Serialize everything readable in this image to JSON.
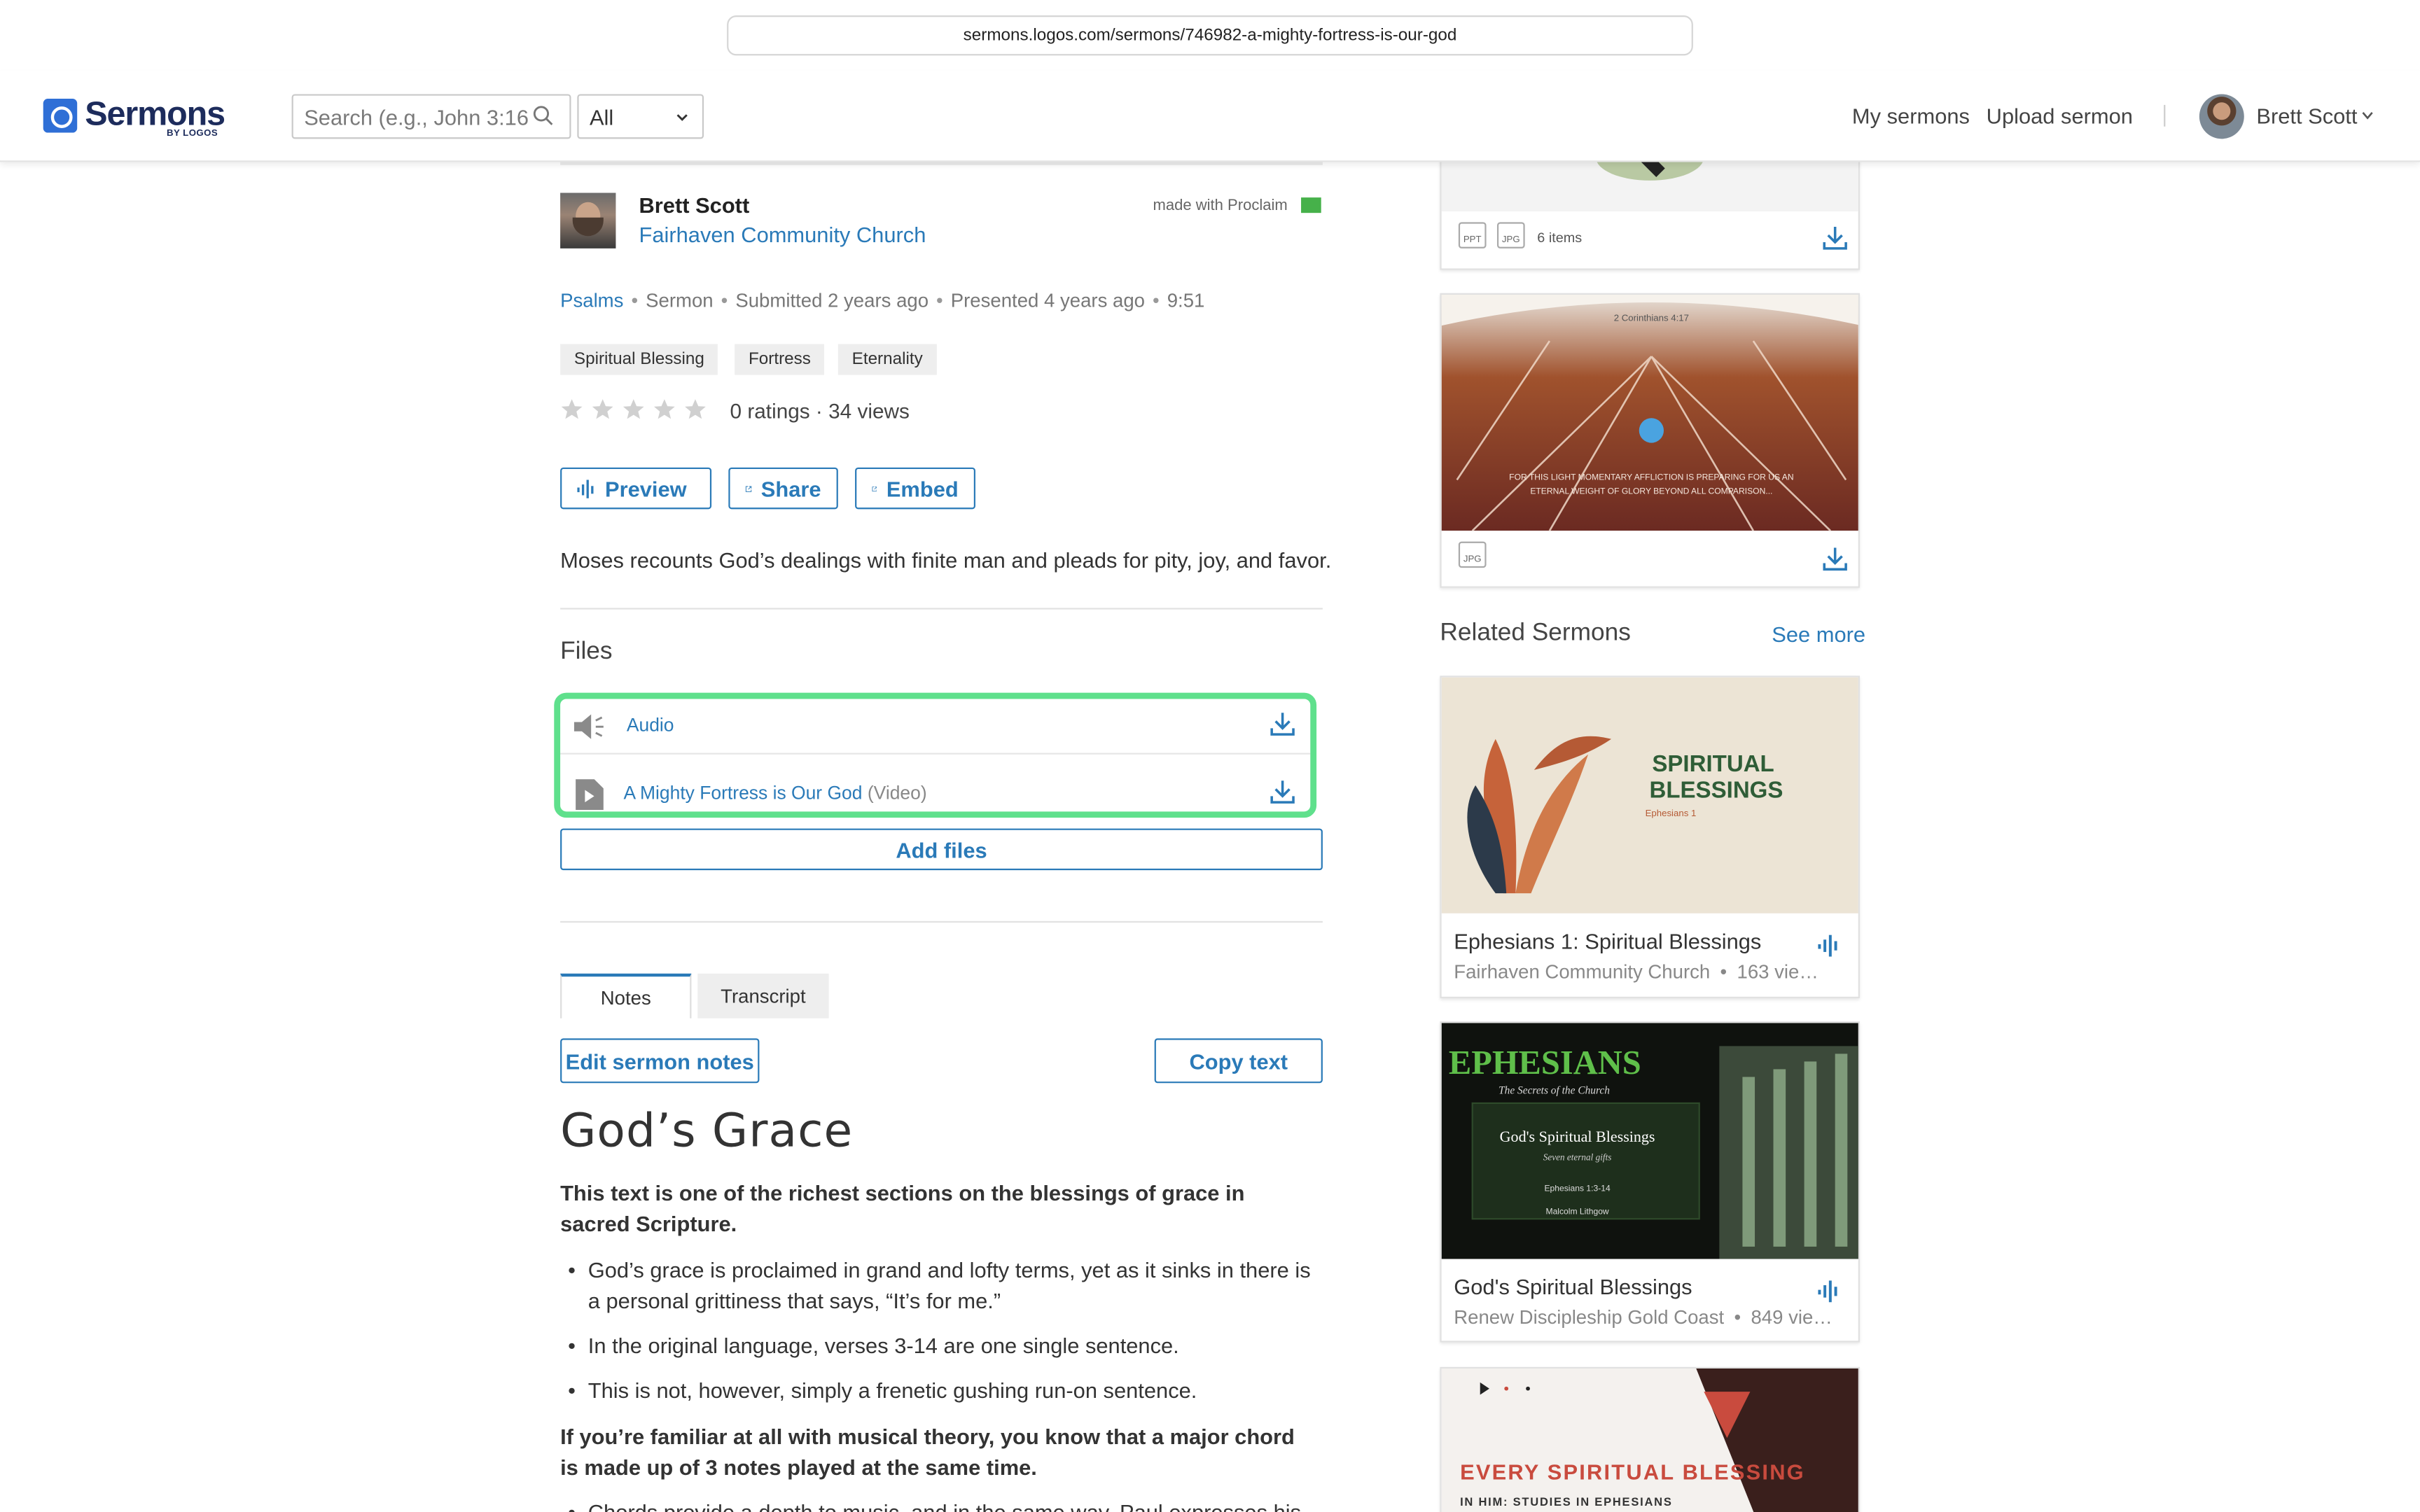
{
  "browser": {
    "url": "sermons.logos.com/sermons/746982-a-mighty-fortress-is-our-god"
  },
  "header": {
    "logo_text": "Sermons",
    "logo_sub": "BY LOGOS",
    "search_placeholder": "Search (e.g., John 3:16)",
    "filter_value": "All",
    "nav": [
      "My sermons",
      "Upload sermon"
    ],
    "user_name": "Brett Scott"
  },
  "sermon": {
    "author": "Brett Scott",
    "church": "Fairhaven Community Church",
    "made_with": "made with Proclaim",
    "meta": {
      "book": "Psalms",
      "type": "Sermon",
      "submitted": "Submitted 2 years ago",
      "presented": "Presented 4 years ago",
      "duration": "9:51"
    },
    "tags": [
      "Spiritual Blessing",
      "Fortress",
      "Eternality"
    ],
    "rating": 0,
    "ratings_text": "0 ratings · 34 views",
    "actions": [
      "Preview",
      "Share",
      "Embed"
    ],
    "description": "Moses recounts God’s dealings with finite man and pleads for pity, joy, and favor.",
    "files_title": "Files",
    "files": [
      {
        "name": "Audio",
        "type": ""
      },
      {
        "name": "A Mighty Fortress is Our God",
        "type": "(Video)"
      }
    ],
    "add_files": "Add files"
  },
  "notes": {
    "tabs": [
      "Notes",
      "Transcript"
    ],
    "active_tab": "Notes",
    "edit_button": "Edit sermon notes",
    "copy_button": "Copy text",
    "heading": "God’s Grace",
    "paragraph1": "This text is one of the richest sections on the blessings of grace in sacred Scripture.",
    "bullets": [
      "God’s grace is proclaimed in grand and lofty terms, yet as it sinks in there is a personal grittiness that says, “It’s for me.”",
      "In the original language, verses 3-14 are one single sentence.",
      "This is not, however, simply a frenetic gushing run-on sentence."
    ],
    "paragraph2": "If you’re familiar at all with musical theory, you know that a major chord is made up of 3 notes played at the same time.",
    "partial_bullet": "Chords provide a depth to music, and in the same way, Paul expresses his"
  },
  "sidebar": {
    "media_card1": {
      "badges": [
        "PPT",
        "JPG"
      ],
      "count": "6 items"
    },
    "media_card2": {
      "badges": [
        "JPG"
      ],
      "image_ref": "2 Corinthians 4:17",
      "image_text": "FOR THIS LIGHT MOMENTARY AFFLICTION IS PREPARING FOR US AN ETERNAL WEIGHT OF GLORY BEYOND ALL COMPARISON..."
    },
    "related_title": "Related Sermons",
    "see_more": "See more",
    "related": [
      {
        "title": "Ephesians 1: Spiritual Blessings",
        "church": "Fairhaven Community Church",
        "views": "163 vie…",
        "thumb_title": "SPIRITUAL BLESSINGS",
        "thumb_sub": "Ephesians 1"
      },
      {
        "title": "God's Spiritual Blessings",
        "church": "Renew Discipleship Gold Coast",
        "views": "849 vie…",
        "thumb_title": "EPHESIANS",
        "thumb_tagline": "The Secrets of the Church",
        "thumb_box_title": "God's Spiritual Blessings",
        "thumb_box_sub": "Seven eternal gifts",
        "thumb_ref": "Ephesians 1:3-14",
        "thumb_author": "Malcolm Lithgow"
      },
      {
        "thumb_title": "EVERY SPIRITUAL BLESSING",
        "thumb_sub": "IN HIM: STUDIES IN EPHESIANS"
      }
    ]
  },
  "colors": {
    "accent": "#2a7ab8",
    "highlight": "#5fe08c",
    "brand": "#2f6fd6"
  }
}
